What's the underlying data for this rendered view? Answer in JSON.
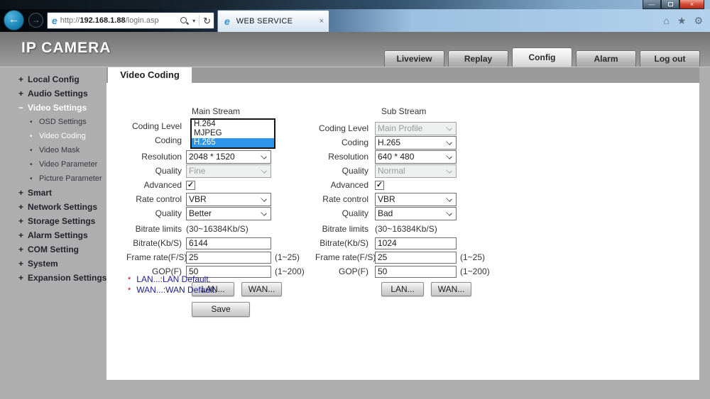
{
  "browser": {
    "back_glyph": "←",
    "forward_glyph": "→",
    "url_prefix": "http://",
    "url_host": "192.168.1.88",
    "url_path": "/login.asp",
    "caret_glyph": "▾",
    "refresh_glyph": "↻",
    "ie_glyph": "e",
    "tab_title": "WEB SERVICE",
    "tab_close_glyph": "×",
    "home_glyph": "⌂",
    "star_glyph": "★",
    "gear_glyph": "⚙",
    "minimize_glyph": "—",
    "close_glyph": "×"
  },
  "header": {
    "title": "IP CAMERA",
    "tabs": [
      {
        "label": "Liveview"
      },
      {
        "label": "Replay"
      },
      {
        "label": "Config",
        "active": true
      },
      {
        "label": "Alarm"
      },
      {
        "label": "Log out"
      }
    ]
  },
  "sidebar": {
    "items": [
      {
        "prefix": "+",
        "label": "Local Config"
      },
      {
        "prefix": "+",
        "label": "Audio Settings"
      },
      {
        "prefix": "−",
        "label": "Video Settings",
        "state": "expanded"
      },
      {
        "prefix": "•",
        "label": "OSD Settings"
      },
      {
        "prefix": "•",
        "label": "Video Coding",
        "state": "active"
      },
      {
        "prefix": "•",
        "label": "Video Mask"
      },
      {
        "prefix": "•",
        "label": "Video Parameter"
      },
      {
        "prefix": "•",
        "label": "Picture Parameter"
      },
      {
        "prefix": "+",
        "label": "Smart"
      },
      {
        "prefix": "+",
        "label": "Network Settings"
      },
      {
        "prefix": "+",
        "label": "Storage Settings"
      },
      {
        "prefix": "+",
        "label": "Alarm Settings"
      },
      {
        "prefix": "+",
        "label": "COM Setting"
      },
      {
        "prefix": "+",
        "label": "System"
      },
      {
        "prefix": "+",
        "label": "Expansion Settings"
      }
    ]
  },
  "content": {
    "page_tab": "Video Coding",
    "labels": {
      "coding_level": "Coding Level",
      "coding": "Coding",
      "resolution": "Resolution",
      "quality": "Quality",
      "advanced": "Advanced",
      "rate_control": "Rate control",
      "bitrate_limits": "Bitrate limits",
      "bitrate": "Bitrate(Kb/S)",
      "frame_rate": "Frame rate(F/S)",
      "gop": "GOP(F)"
    },
    "main_stream": {
      "title": "Main Stream",
      "coding_options": [
        "H.264",
        "MJPEG",
        "H.265"
      ],
      "coding_selected": "H.265",
      "resolution": "2048 * 1520",
      "quality": "Fine",
      "advanced_checked": "✓",
      "rate_control": "VBR",
      "quality2": "Better",
      "bitrate_limits": "(30~16384Kb/S)",
      "bitrate": "6144",
      "frame_rate": "25",
      "frame_rate_range": "(1~25)",
      "gop": "50",
      "gop_range": "(1~200)",
      "lan_button": "LAN...",
      "wan_button": "WAN..."
    },
    "sub_stream": {
      "title": "Sub Stream",
      "coding_level": "Main Profile",
      "coding": "H.265",
      "resolution": "640 * 480",
      "quality": "Normal",
      "advanced_checked": "✓",
      "rate_control": "VBR",
      "quality2": "Bad",
      "bitrate_limits": "(30~16384Kb/S)",
      "bitrate": "1024",
      "frame_rate": "25",
      "frame_rate_range": "(1~25)",
      "gop": "50",
      "gop_range": "(1~200)",
      "lan_button": "LAN...",
      "wan_button": "WAN..."
    },
    "save_button": "Save",
    "footnotes": [
      {
        "marker": "*",
        "text": "LAN...:LAN Default."
      },
      {
        "marker": "*",
        "text": "WAN...:WAN Default."
      }
    ]
  }
}
